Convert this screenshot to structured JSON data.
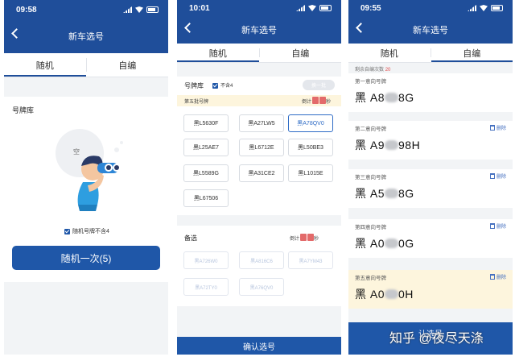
{
  "screen1": {
    "time": "09:58",
    "title": "新车选号",
    "tabs": [
      "随机",
      "自编"
    ],
    "section": "号牌库",
    "empty_label": "空",
    "checkbox": "随机号牌不含4",
    "button": "随机一次(5)"
  },
  "screen2": {
    "time": "10:01",
    "title": "新车选号",
    "tabs": [
      "随机",
      "自编"
    ],
    "section": "号牌库",
    "filter": "不含4",
    "refresh": "换一批",
    "batch": "第五批号牌",
    "countdown_prefix": "倒计",
    "countdown_suffix": "秒",
    "plates": [
      "黑L5630F",
      "黑A27LW5",
      "黑A78QV0",
      "黑L25AE7",
      "黑L6712E",
      "黑L50BE3",
      "黑L5589G",
      "黑A31CE2",
      "黑L1015E",
      "黑L67506"
    ],
    "selected_index": 2,
    "reserve_title": "备选",
    "reserve_countdown_prefix": "倒计",
    "reserve_countdown_suffix": "秒",
    "reserve": [
      "黑A726W0",
      "黑A816C6",
      "黑A7YM43",
      "黑A72TY0",
      "黑A76QV0"
    ],
    "confirm": "确认选号"
  },
  "screen3": {
    "time": "09:55",
    "title": "新车选号",
    "tabs": [
      "随机",
      "自编"
    ],
    "remaining_label": "剩余自编次数",
    "remaining": "20",
    "delete_label": "删除",
    "cards": [
      {
        "label": "第一意向号牌",
        "pre": "黑 A8",
        "post": "8G",
        "del": false
      },
      {
        "label": "第二意向号牌",
        "pre": "黑 A9",
        "post": "98H",
        "del": true
      },
      {
        "label": "第三意向号牌",
        "pre": "黑 A5",
        "post": "8G",
        "del": true
      },
      {
        "label": "第四意向号牌",
        "pre": "黑 A0",
        "post": "0G",
        "del": true
      },
      {
        "label": "第五意向号牌",
        "pre": "黑 A0",
        "post": "0H",
        "del": true
      }
    ],
    "bottom_button": "认选号"
  },
  "watermark": "知乎 @夜尽天涤",
  "colors": {
    "primary": "#1f4e9a",
    "accent": "#e24b4b",
    "highlight": "#fdf5dd"
  }
}
